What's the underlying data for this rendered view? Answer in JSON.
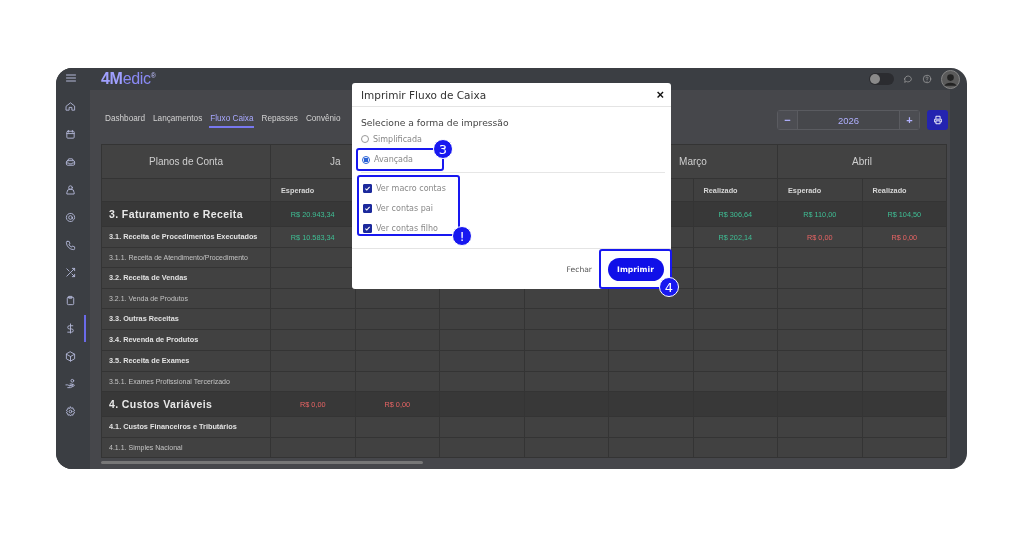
{
  "topbar": {
    "logo": "**4M**edic$^{®}$",
    "toggle_switch": {
      "on": false
    }
  },
  "sidebar": {
    "items": [
      {
        "selected": false
      },
      {
        "selected": false
      },
      {
        "selected": false
      },
      {
        "selected": false
      },
      {
        "selected": false
      },
      {
        "selected": false
      },
      {
        "selected": false
      },
      {
        "selected": false
      },
      {
        "selected": true
      },
      {
        "selected": false
      },
      {
        "selected": false
      },
      {
        "selected": false
      }
    ]
  },
  "tabs": [
    {
      "label": "Dashboard",
      "selected": false
    },
    {
      "label": "Lançamentos",
      "selected": false
    },
    {
      "label": "Fluxo Caixa",
      "selected": true
    },
    {
      "label": "Repasses",
      "selected": false
    },
    {
      "label": "Convênio",
      "selected": false
    }
  ],
  "year_stepper": {
    "decrement": "−",
    "year": "2026",
    "increment": "+"
  },
  "table": {
    "corner_header": "Planos de Conta",
    "months": {
      "janeiro": {
        "label": "Ja",
        "expected": "Esperado"
      },
      "marco": {
        "label": "Março",
        "actual": "Realizado"
      },
      "abril": {
        "label": "Abril",
        "expected": "Esperado",
        "actual": "Realizado"
      }
    },
    "rows": [
      {
        "label": "3. Faturamento e Receita",
        "kind": "group",
        "cells": {
          "janeiro_expected": {
            "text": "R$ 20.943,34",
            "negative": false
          },
          "marco_actual": {
            "text": "R$ 306,64",
            "negative": false
          },
          "abril_expected": {
            "text": "R$ 110,00",
            "negative": false
          },
          "abril_actual": {
            "text": "R$ 104,50",
            "negative": false
          }
        }
      },
      {
        "label": "3.1. Receita de Procedimentos Executados",
        "kind": "subgroup",
        "cells": {
          "janeiro_expected": {
            "text": "R$ 10.583,34",
            "negative": false
          },
          "marco_actual": {
            "text": "R$ 202,14",
            "negative": false
          },
          "abril_expected": {
            "text": "R$ 0,00",
            "negative": true
          },
          "abril_actual": {
            "text": "R$ 0,00",
            "negative": true
          }
        }
      },
      {
        "label": "3.1.1. Receita de Atendimento/Procedimento",
        "kind": "item"
      },
      {
        "label": "3.2. Receita de Vendas",
        "kind": "subgroup"
      },
      {
        "label": "3.2.1. Venda de Produtos",
        "kind": "item"
      },
      {
        "label": "3.3. Outras Receitas",
        "kind": "subgroup"
      },
      {
        "label": "3.4. Revenda de Produtos",
        "kind": "subgroup"
      },
      {
        "label": "3.5. Receita de Exames",
        "kind": "subgroup"
      },
      {
        "label": "3.5.1. Exames Profissional Tercerizado",
        "kind": "item"
      },
      {
        "label": "4. Custos Variáveis",
        "kind": "group",
        "cells": {
          "janeiro_expected": {
            "text": "R$ 0,00",
            "negative": true
          },
          "janeiro_actual": {
            "text": "R$ 0,00",
            "negative": true
          }
        }
      },
      {
        "label": "4.1. Custos Financeiros e Tributários",
        "kind": "subgroup"
      },
      {
        "label": "4.1.1. Simples Nacional",
        "kind": "item"
      }
    ]
  },
  "dialog": {
    "title": "Imprimir Fluxo de Caixa",
    "close": "×",
    "prompt": "Selecione a forma de impressão",
    "radios": [
      {
        "label": "Simplificada",
        "selected": false
      },
      {
        "label": "Avançada",
        "selected": true,
        "callout": "3"
      }
    ],
    "checkboxes": {
      "callout": "!",
      "items": [
        {
          "label": "Ver macro contas",
          "checked": true
        },
        {
          "label": "Ver contas pai",
          "checked": true
        },
        {
          "label": "Ver contas filho",
          "checked": true
        }
      ]
    },
    "cancel_button": {
      "label": "Fechar"
    },
    "print_button": {
      "label": "Imprimir",
      "callout": "4"
    }
  }
}
